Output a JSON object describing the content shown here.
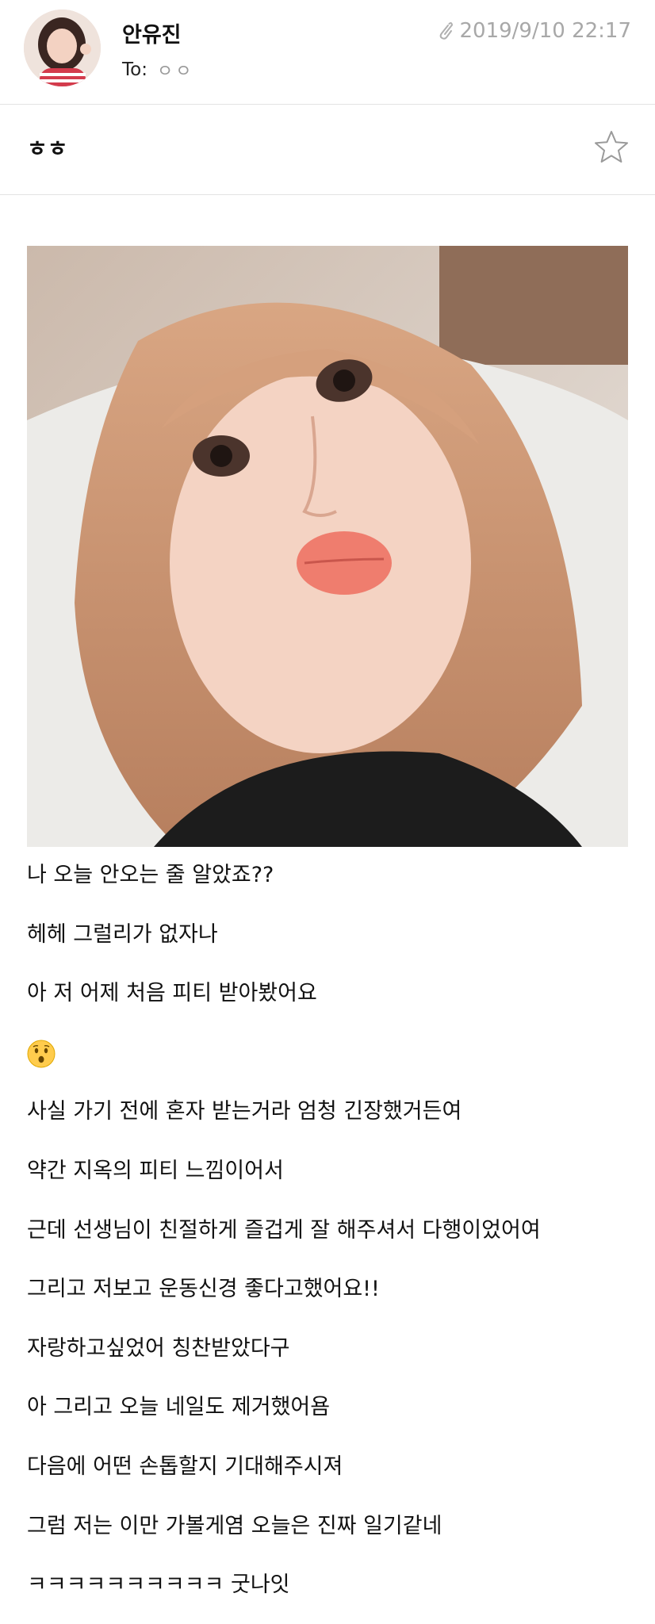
{
  "header": {
    "sender_name": "안유진",
    "to_label": "To:",
    "to_value": "ㅇㅇ",
    "date": "2019/9/10 22:17",
    "attachment_icon": "paperclip-icon"
  },
  "subject": {
    "title": "ㅎㅎ",
    "star_icon": "star-outline-icon"
  },
  "body": {
    "photo": "selfie-photo",
    "lines": [
      "나 오늘 안오는 줄 알았죠??",
      "헤헤 그럴리가 없자나",
      "아 저 어제 처음 피티 받아봤어요",
      "",
      "사실 가기 전에 혼자 받는거라 엄청 긴장했거든여",
      "약간 지옥의 피티 느낌이어서",
      "근데 선생님이 친절하게 즐겁게 잘 해주셔서 다행이었어여",
      "그리고 저보고 운동신경 좋다고했어요!!",
      "자랑하고싶었어 칭찬받았다구",
      "아 그리고 오늘 네일도 제거했어욤",
      "다음에 어떤 손톱할지 기대해주시져",
      "그럼 저는 이만 가볼게염 오늘은 진짜 일기같네",
      "ㅋㅋㅋㅋㅋㅋㅋㅋㅋㅋ 굿나잇"
    ],
    "emoji": "hushed-face-emoji"
  },
  "colors": {
    "meta_gray": "#a8a8a8",
    "divider": "#e3e3e3",
    "text": "#111111"
  }
}
